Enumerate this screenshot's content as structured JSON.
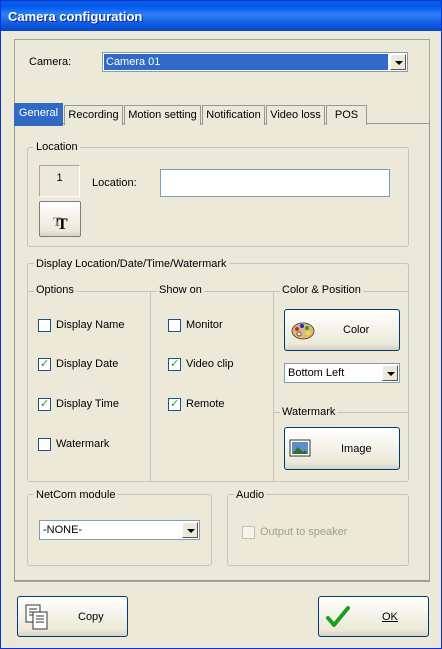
{
  "window": {
    "title": "Camera configuration"
  },
  "camera": {
    "label": "Camera:",
    "selected": "Camera 01"
  },
  "tabs": [
    "General",
    "Recording",
    "Motion setting",
    "Notification",
    "Video loss",
    "POS"
  ],
  "location": {
    "group_title": "Location",
    "number": "1",
    "field_label": "Location:",
    "field_value": "",
    "font_button_icon": "text-font-icon"
  },
  "display": {
    "group_title": "Display Location/Date/Time/Watermark",
    "options": {
      "title": "Options",
      "items": [
        {
          "label": "Display Name",
          "checked": false
        },
        {
          "label": "Display Date",
          "checked": true
        },
        {
          "label": "Display Time",
          "checked": true
        },
        {
          "label": "Watermark",
          "checked": false
        }
      ]
    },
    "show_on": {
      "title": "Show on",
      "items": [
        {
          "label": "Monitor",
          "checked": false
        },
        {
          "label": "Video clip",
          "checked": true
        },
        {
          "label": "Remote",
          "checked": true
        }
      ]
    },
    "color_position": {
      "title": "Color & Position",
      "color_button": "Color",
      "color_icon": "palette-icon",
      "position_selected": "Bottom Left"
    },
    "watermark": {
      "title": "Watermark",
      "image_button": "Image",
      "image_icon": "picture-icon"
    }
  },
  "netcom": {
    "title": "NetCom module",
    "selected": "-NONE-"
  },
  "audio": {
    "title": "Audio",
    "output_label": "Output to speaker",
    "checked": false,
    "enabled": false
  },
  "footer": {
    "copy_button": "Copy",
    "copy_icon": "copy-document-icon",
    "ok_button": "OK",
    "ok_icon": "checkmark-icon"
  },
  "colors": {
    "title_bar": "#0058ee",
    "tab_active": "#316ac5",
    "window_bg": "#ece9d8",
    "check": "#21a121"
  }
}
